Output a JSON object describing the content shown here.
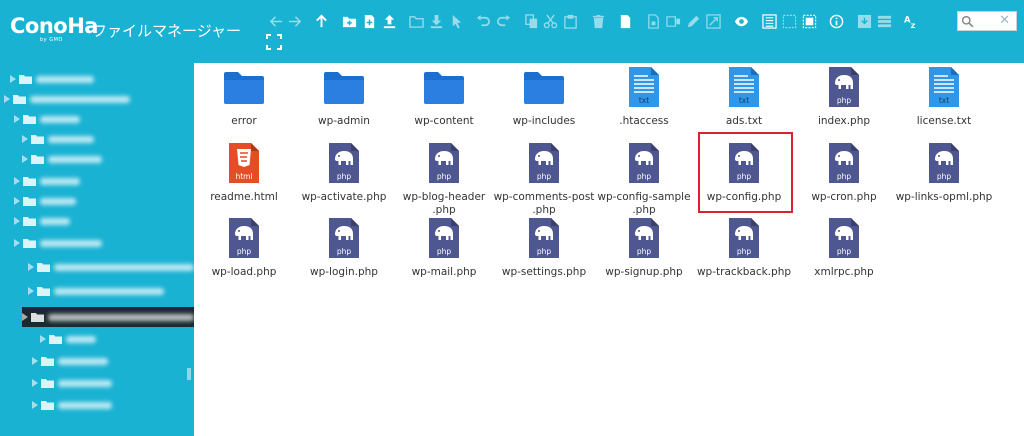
{
  "header": {
    "logo_text": "ConoHa",
    "logo_sub": "by GMO",
    "app_title": "ファイルマネージャー",
    "background": "#1ab2d3"
  },
  "toolbar": {
    "icons": [
      "back-arrow-icon",
      "forward-arrow-icon",
      "up-arrow-icon",
      "new-folder-icon",
      "new-file-icon",
      "upload-icon",
      "open-icon",
      "download-icon",
      "select-icon",
      "undo-icon",
      "redo-icon",
      "copy-icon",
      "cut-icon",
      "paste-icon",
      "delete-icon",
      "duplicate-icon",
      "archive-icon",
      "extract-icon",
      "edit-icon",
      "resize-icon",
      "preview-icon",
      "select-all-icon",
      "deselect-icon",
      "invert-select-icon",
      "info-icon",
      "view-icons-icon",
      "view-list-icon",
      "sort-icon"
    ]
  },
  "search": {
    "value": "",
    "placeholder": ""
  },
  "files": [
    {
      "name": "error",
      "type": "folder"
    },
    {
      "name": "wp-admin",
      "type": "folder"
    },
    {
      "name": "wp-content",
      "type": "folder"
    },
    {
      "name": "wp-includes",
      "type": "folder"
    },
    {
      "name": ".htaccess",
      "type": "txt"
    },
    {
      "name": "ads.txt",
      "type": "txt"
    },
    {
      "name": "index.php",
      "type": "php"
    },
    {
      "name": "license.txt",
      "type": "txt"
    },
    {
      "name": "readme.html",
      "type": "html"
    },
    {
      "name": "wp-activate.php",
      "type": "php"
    },
    {
      "name": "wp-blog-header\n.php",
      "type": "php"
    },
    {
      "name": "wp-comments-post\n.php",
      "type": "php"
    },
    {
      "name": "wp-config-sample\n.php",
      "type": "php"
    },
    {
      "name": "wp-config.php",
      "type": "php",
      "highlighted": true
    },
    {
      "name": "wp-cron.php",
      "type": "php"
    },
    {
      "name": "wp-links-opml.php",
      "type": "php"
    },
    {
      "name": "wp-load.php",
      "type": "php"
    },
    {
      "name": "wp-login.php",
      "type": "php"
    },
    {
      "name": "wp-mail.php",
      "type": "php"
    },
    {
      "name": "wp-settings.php",
      "type": "php"
    },
    {
      "name": "wp-signup.php",
      "type": "php"
    },
    {
      "name": "wp-trackback.php",
      "type": "php"
    },
    {
      "name": "xmlrpc.php",
      "type": "php"
    }
  ],
  "icon_labels": {
    "txt": "txt",
    "php": "php",
    "html": "html"
  },
  "colors": {
    "folder": "#1d6fcf",
    "txt_doc": "#2f96e8",
    "php_doc": "#4f5791",
    "html_doc": "#e44d26",
    "highlight": "#d9232e"
  }
}
